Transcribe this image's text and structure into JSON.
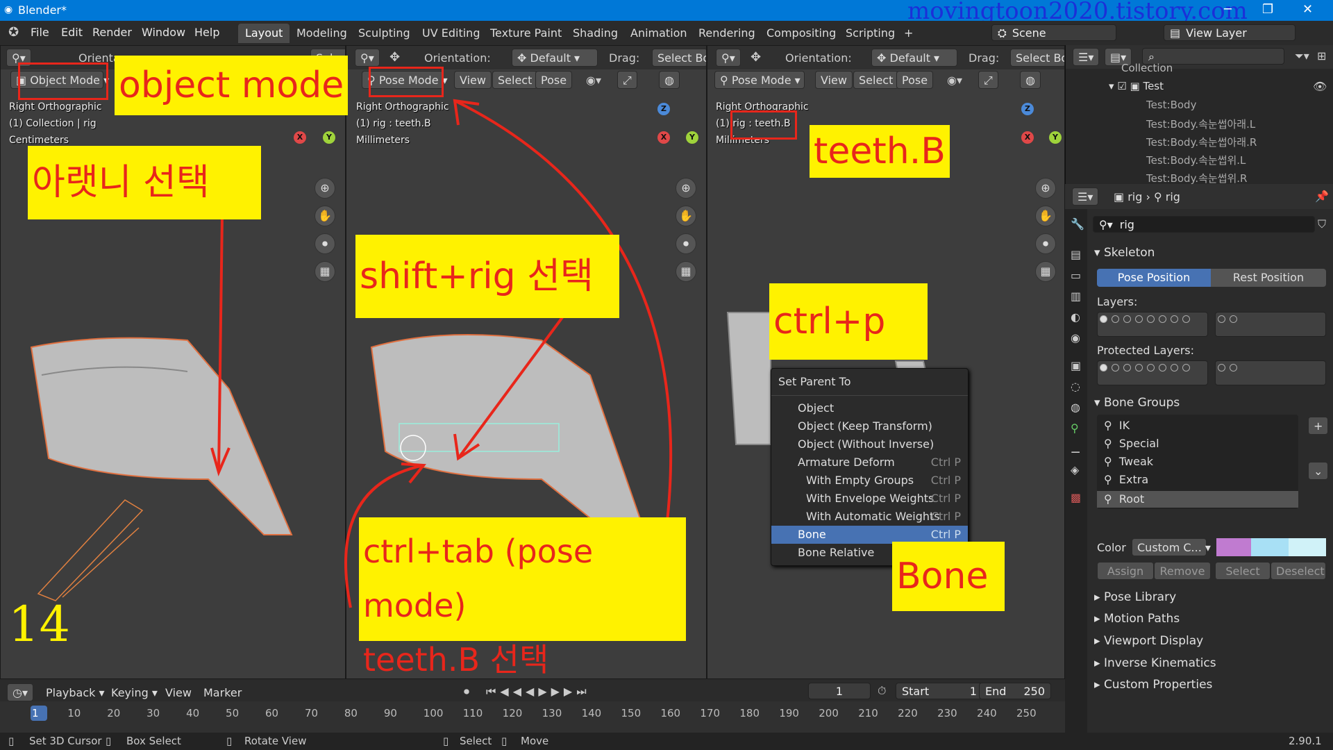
{
  "window": {
    "title": "Blender*",
    "watermark": "movingtoon2020.tistory.com",
    "controls": [
      "─",
      "❐",
      "✕"
    ]
  },
  "menu": [
    "File",
    "Edit",
    "Render",
    "Window",
    "Help"
  ],
  "workspaces": [
    "Layout",
    "Modeling",
    "Sculpting",
    "UV Editing",
    "Texture Paint",
    "Shading",
    "Animation",
    "Rendering",
    "Compositing",
    "Scripting",
    "+"
  ],
  "scene": "Scene",
  "view_layer": "View Layer",
  "vp1": {
    "orientation": "Orienta",
    "select": "Select",
    "mode": "Object Mode",
    "view": "Right Orthographic",
    "collection": "(1) Collection | rig",
    "units": "Centimeters"
  },
  "vp2": {
    "orientation_label": "Orientation:",
    "orientation": "Default",
    "drag": "Drag:",
    "drag_value": "Select Bo",
    "mode": "Pose Mode",
    "menus": [
      "View",
      "Select",
      "Pose"
    ],
    "view": "Right Orthographic",
    "bone": "(1) rig : teeth.B",
    "units": "Millimeters"
  },
  "vp3": {
    "orientation_label": "Orientation:",
    "orientation": "Default",
    "drag": "Drag:",
    "drag_value": "Select Bo",
    "mode": "Pose Mode",
    "menus": [
      "View",
      "Select",
      "Pose"
    ],
    "view": "Right Orthographic",
    "bone": "(1) rig : teeth.B",
    "units": "Millimeters"
  },
  "axes": {
    "x": "X",
    "y": "Y",
    "z": "Z"
  },
  "annotations": {
    "object_mode": "object mode",
    "lower_teeth": "아랫니 선택",
    "shift_rig": "shift+rig 선택",
    "ctrl_tab": "ctrl+tab (pose mode)",
    "teeth_select": "teeth.B 선택",
    "teeth_b": "teeth.B",
    "ctrl_p": "ctrl+p",
    "bone": "Bone",
    "step": "14"
  },
  "context_menu": {
    "title": "Set Parent To",
    "items": [
      {
        "label": "Object",
        "shortcut": ""
      },
      {
        "label": "Object (Keep Transform)",
        "shortcut": ""
      },
      {
        "label": "Object (Without Inverse)",
        "shortcut": ""
      },
      {
        "label": "Armature Deform",
        "shortcut": "Ctrl P"
      },
      {
        "label": "With Empty Groups",
        "shortcut": "Ctrl P"
      },
      {
        "label": "With Envelope Weights",
        "shortcut": "Ctrl P"
      },
      {
        "label": "With Automatic Weights",
        "shortcut": "Ctrl P"
      },
      {
        "label": "Bone",
        "shortcut": "Ctrl P"
      },
      {
        "label": "Bone Relative",
        "shortcut": ""
      }
    ]
  },
  "outliner": {
    "items": [
      "Collection",
      "Test",
      "Test:Body",
      "Test:Body.속눈썹아래.L",
      "Test:Body.속눈썹아래.R",
      "Test:Body.속눈썹위.L",
      "Test:Body.속눈썹위.R"
    ]
  },
  "properties": {
    "breadcrumb_a": "rig",
    "breadcrumb_b": "rig",
    "name": "rig",
    "skeleton": "Skeleton",
    "pose_position": "Pose Position",
    "rest_position": "Rest Position",
    "layers": "Layers:",
    "protected_layers": "Protected Layers:",
    "bone_groups": "Bone Groups",
    "groups": [
      "IK",
      "Special",
      "Tweak",
      "Extra",
      "Root"
    ],
    "color_label": "Color",
    "color_value": "Custom C...",
    "assign": "Assign",
    "remove": "Remove",
    "select": "Select",
    "deselect": "Deselect",
    "panels": [
      "Pose Library",
      "Motion Paths",
      "Viewport Display",
      "Inverse Kinematics",
      "Custom Properties"
    ],
    "swatches": [
      "#c07bd0",
      "#a8e0f5",
      "#d0f2f8"
    ]
  },
  "timeline": {
    "playback": "Playback",
    "keying": "Keying",
    "view": "View",
    "marker": "Marker",
    "frame": "1",
    "start_label": "Start",
    "start": "1",
    "end_label": "End",
    "end": "250",
    "ticks": [
      "1",
      "10",
      "20",
      "30",
      "40",
      "50",
      "60",
      "70",
      "80",
      "90",
      "100",
      "110",
      "120",
      "130",
      "140",
      "150",
      "160",
      "170",
      "180",
      "190",
      "200",
      "210",
      "220",
      "230",
      "240",
      "250"
    ]
  },
  "status": {
    "items": [
      "Set 3D Cursor",
      "Box Select",
      "Rotate View",
      "Select",
      "Move"
    ],
    "version": "2.90.1"
  }
}
